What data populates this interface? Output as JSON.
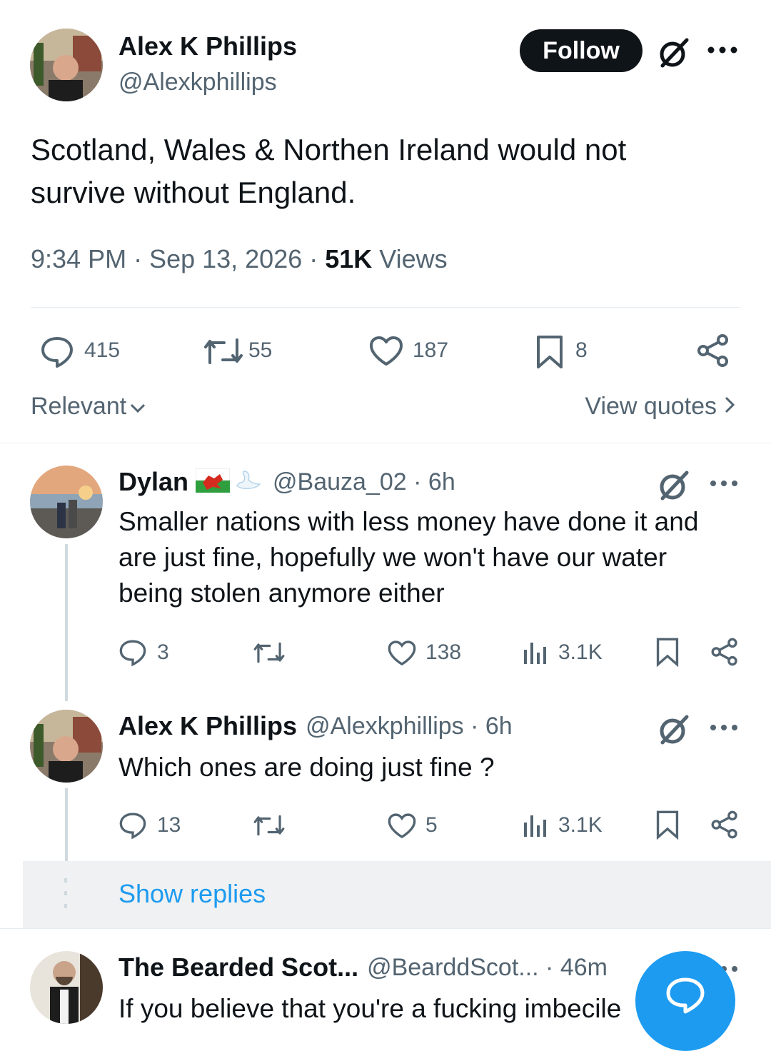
{
  "main_tweet": {
    "author_name": "Alex K Phillips",
    "handle": "@Alexkphillips",
    "follow_label": "Follow",
    "text_line1": "Scotland, Wales & Northen Ireland would not",
    "text_line2": "survive without England.",
    "time": "9:34 PM · Sep 13, 2026 · ",
    "views_count": "51K",
    "views_label": " Views",
    "replies": "415",
    "reposts": "55",
    "likes": "187",
    "bookmarks": "8"
  },
  "filters": {
    "sort_label": "Relevant",
    "quotes_label": "View quotes"
  },
  "replies": [
    {
      "author_name": "Dylan",
      "handle": "@Bauza_02 · 6h",
      "text_line1": "Smaller nations with less money have done it and",
      "text_line2": "are just fine, hopefully we won't have our water",
      "text_line3": "being stolen anymore either",
      "replies": "3",
      "likes": "138",
      "views": "3.1K"
    },
    {
      "author_name": "Alex K Phillips",
      "handle": "@Alexkphillips · 6h",
      "text_line1": "Which ones are doing just fine ?",
      "replies": "13",
      "likes": "5",
      "views": "3.1K"
    },
    {
      "author_name": "The Bearded Scot...",
      "handle": "@BearddScot... · 46m",
      "text_line1": "If you believe that you're a fucking imbecile"
    }
  ],
  "show_replies_label": "Show replies",
  "colors": {
    "accent": "#1d9bf0",
    "text": "#0f1419",
    "secondary": "#536471"
  }
}
